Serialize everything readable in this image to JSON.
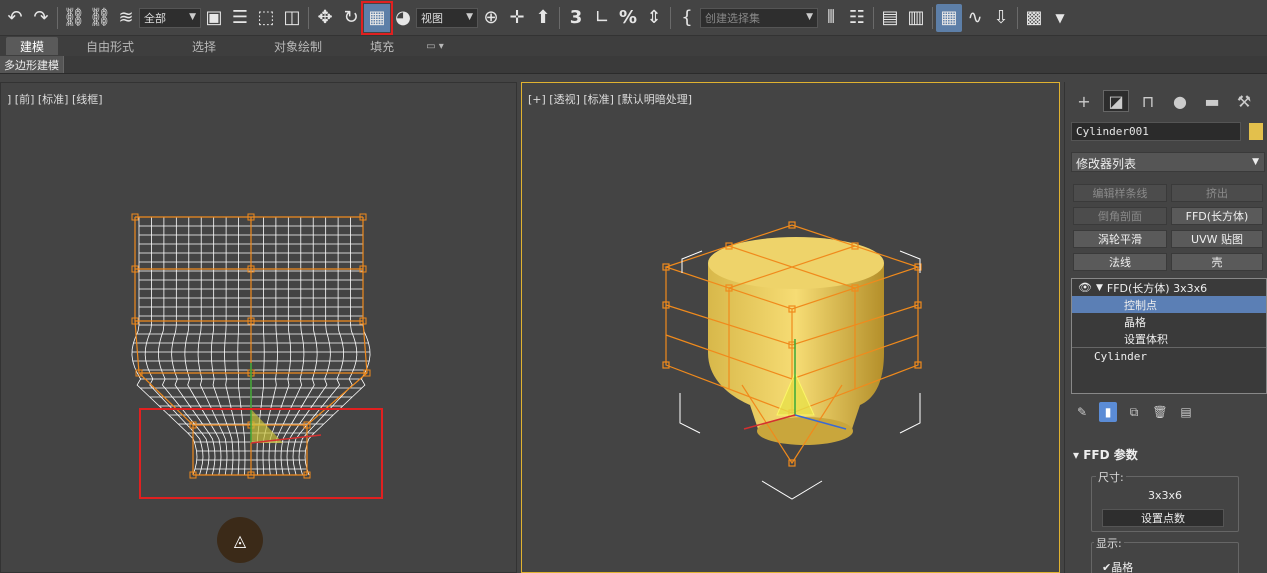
{
  "toolbar": {
    "selection_filter": "全部",
    "ref_coord": "视图",
    "named_selection_placeholder": "创建选择集",
    "snap_3": "3",
    "snap_2": "2",
    "percent": "%"
  },
  "ribbon": {
    "tabs": [
      "建模",
      "自由形式",
      "选择",
      "对象绘制",
      "填充"
    ],
    "active_tab": "建模",
    "sub_tab": "多边形建模"
  },
  "viewports": {
    "left_label": "] [前] [标准] [线框]",
    "right_label": "[+] [透视] [标准] [默认明暗处理]"
  },
  "panel": {
    "object_name": "Cylinder001",
    "modifier_list": "修改器列表",
    "buttons": [
      {
        "label": "编辑样条线",
        "enabled": false
      },
      {
        "label": "挤出",
        "enabled": false
      },
      {
        "label": "倒角剖面",
        "enabled": false
      },
      {
        "label": "FFD(长方体)",
        "enabled": true
      },
      {
        "label": "涡轮平滑",
        "enabled": true
      },
      {
        "label": "UVW 贴图",
        "enabled": true
      },
      {
        "label": "法线",
        "enabled": true
      },
      {
        "label": "壳",
        "enabled": true
      }
    ],
    "stack": {
      "modifier": "FFD(长方体) 3x3x6",
      "sub_items": [
        "控制点",
        "晶格",
        "设置体积"
      ],
      "selected_sub": "控制点",
      "base": "Cylinder"
    },
    "ffd": {
      "title": "FFD 参数",
      "dims_label": "尺寸:",
      "dims_value": "3x3x6",
      "set_points": "设置点数",
      "display_label": "显示:",
      "lattice_check": "晶格"
    }
  },
  "colors": {
    "accent_yellow": "#e3c04c",
    "select_blue": "#5b7fb5",
    "highlight_red": "#e02020",
    "lattice_orange": "#f08a1c"
  }
}
